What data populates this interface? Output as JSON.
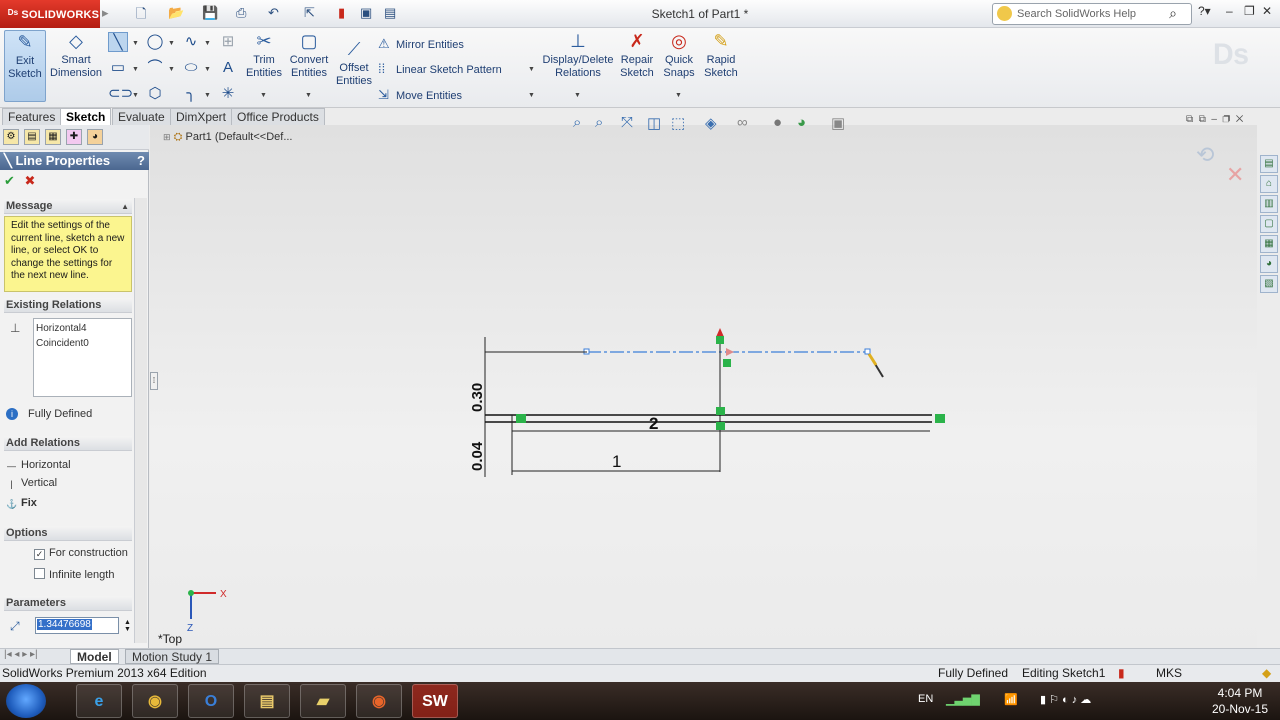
{
  "app": {
    "logo_text": "SOLIDWORKS",
    "doc_title": "Sketch1 of Part1 *",
    "search_placeholder": "Search SolidWorks Help"
  },
  "command_manager": {
    "exit_sketch": "Exit Sketch",
    "smart_dimension": "Smart Dimension",
    "trim_entities": "Trim Entities",
    "convert_entities": "Convert Entities",
    "offset_entities": "Offset Entities",
    "mirror_entities": "Mirror Entities",
    "linear_sketch_pattern": "Linear Sketch Pattern",
    "move_entities": "Move Entities",
    "display_delete_relations": "Display/Delete Relations",
    "repair_sketch": "Repair Sketch",
    "quick_snaps": "Quick Snaps",
    "rapid_sketch": "Rapid Sketch"
  },
  "tabs": [
    "Features",
    "Sketch",
    "Evaluate",
    "DimXpert",
    "Office Products"
  ],
  "active_tab": "Sketch",
  "property_manager": {
    "title": "Line Properties",
    "help": "?",
    "message_header": "Message",
    "message": "Edit the settings of the current line, sketch a new line, or select OK to change the settings for the next new line.",
    "existing_relations_header": "Existing Relations",
    "relations": [
      "Horizontal4",
      "Coincident0"
    ],
    "status": "Fully Defined",
    "add_relations_header": "Add Relations",
    "add_relations": [
      "Horizontal",
      "Vertical",
      "Fix"
    ],
    "options_header": "Options",
    "for_construction_label": "For construction",
    "for_construction_checked": true,
    "infinite_length_label": "Infinite length",
    "infinite_length_checked": false,
    "parameters_header": "Parameters",
    "length_value": "1.34476698"
  },
  "feature_tree": {
    "root": "Part1  (Default<<Def..."
  },
  "sketch": {
    "dim_vertical_1": "0.30",
    "dim_vertical_2": "0.04",
    "dim_horizontal_1": "2",
    "dim_horizontal_2": "1",
    "view_label": "*Top",
    "axis_x": "X",
    "axis_z": "Z"
  },
  "bottom_tabs": [
    "Model",
    "Motion Study 1"
  ],
  "status_bar": {
    "edition": "SolidWorks Premium 2013 x64 Edition",
    "state": "Fully Defined",
    "editing": "Editing Sketch1",
    "units": "MKS"
  },
  "taskbar": {
    "language": "EN",
    "time": "4:04 PM",
    "date": "20-Nov-15"
  },
  "colors": {
    "brand": "#c8281b",
    "title_bar": "#4b6790",
    "message_bg": "#fbf58f",
    "construction_line": "#3d7fd9",
    "relation_marker": "#2bb34a"
  }
}
